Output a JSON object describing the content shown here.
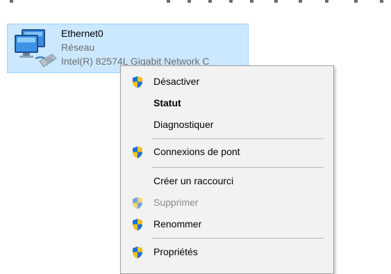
{
  "adapter": {
    "name": "Ethernet0",
    "network": "Réseau",
    "device": "Intel(R) 82574L Gigabit Network C",
    "icon": "network-adapter-icon"
  },
  "context_menu": {
    "items": [
      {
        "label": "Désactiver",
        "shield": true,
        "bold": false,
        "enabled": true
      },
      {
        "label": "Statut",
        "shield": false,
        "bold": true,
        "enabled": true
      },
      {
        "label": "Diagnostiquer",
        "shield": false,
        "bold": false,
        "enabled": true
      },
      {
        "label": "Connexions de pont",
        "shield": true,
        "bold": false,
        "enabled": true
      },
      {
        "label": "Créer un raccourci",
        "shield": false,
        "bold": false,
        "enabled": true
      },
      {
        "label": "Supprimer",
        "shield": true,
        "bold": false,
        "enabled": false
      },
      {
        "label": "Renommer",
        "shield": true,
        "bold": false,
        "enabled": true
      },
      {
        "label": "Propriétés",
        "shield": true,
        "bold": false,
        "enabled": true
      }
    ]
  },
  "colors": {
    "selection_bg": "#cce8ff",
    "selection_border": "#99d1ff",
    "menu_bg": "#f2f2f2",
    "shield_blue": "#1f6fd1",
    "shield_yellow": "#f3c21b"
  }
}
